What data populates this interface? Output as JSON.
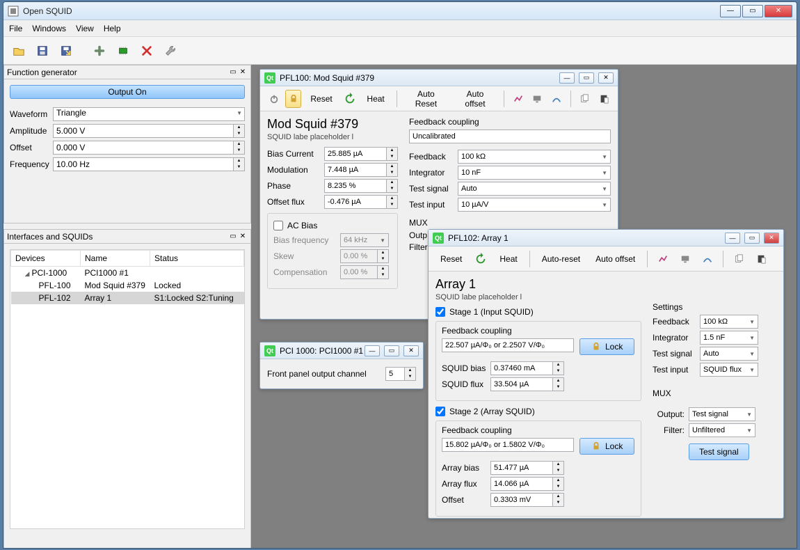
{
  "window": {
    "title": "Open SQUID"
  },
  "menu": {
    "items": [
      "File",
      "Windows",
      "View",
      "Help"
    ]
  },
  "fn_gen": {
    "title": "Function generator",
    "output_btn": "Output On",
    "waveform_label": "Waveform",
    "waveform_value": "Triangle",
    "amplitude_label": "Amplitude",
    "amplitude_value": "5.000 V",
    "offset_label": "Offset",
    "offset_value": "0.000 V",
    "frequency_label": "Frequency",
    "frequency_value": "10.00 Hz"
  },
  "interfaces": {
    "title": "Interfaces and SQUIDs",
    "cols": [
      "Devices",
      "Name",
      "Status"
    ],
    "rows": [
      {
        "indent": 1,
        "expand": true,
        "device": "PCI-1000",
        "name": "PCI1000 #1",
        "status": ""
      },
      {
        "indent": 2,
        "device": "PFL-100",
        "name": "Mod Squid #379",
        "status": "Locked"
      },
      {
        "indent": 2,
        "selected": true,
        "device": "PFL-102",
        "name": "Array 1",
        "status": "S1:Locked  S2:Tuning"
      }
    ]
  },
  "pfl100": {
    "title": "PFL100: Mod Squid #379",
    "toolbar": {
      "reset": "Reset",
      "heat": "Heat",
      "auto_reset": "Auto Reset",
      "auto_offset": "Auto offset"
    },
    "h1": "Mod Squid #379",
    "sub": "SQUID labe placeholder l",
    "left": {
      "bias_current_label": "Bias Current",
      "bias_current": "25.885 µA",
      "modulation_label": "Modulation",
      "modulation": "7.448 µA",
      "phase_label": "Phase",
      "phase": "8.235 %",
      "offset_flux_label": "Offset flux",
      "offset_flux": "-0.476 µA",
      "ac_bias_label": "AC Bias",
      "bias_freq_label": "Bias frequency",
      "bias_freq": "64 kHz",
      "skew_label": "Skew",
      "skew": "0.00 %",
      "comp_label": "Compensation",
      "comp": "0.00 %"
    },
    "right": {
      "fc_label": "Feedback coupling",
      "fc": "Uncalibrated",
      "feedback_label": "Feedback",
      "feedback": "100 kΩ",
      "integrator_label": "Integrator",
      "integrator": "10 nF",
      "test_signal_label": "Test signal",
      "test_signal": "Auto",
      "test_input_label": "Test input",
      "test_input": "10 µA/V",
      "mux_label": "MUX",
      "output_label": "Outp",
      "filter_label": "Filter:"
    }
  },
  "pci1000": {
    "title": "PCI 1000: PCI1000 #1",
    "front_label": "Front panel output channel",
    "front_value": "5"
  },
  "pfl102": {
    "title": "PFL102: Array 1",
    "toolbar": {
      "reset": "Reset",
      "heat": "Heat",
      "auto_reset": "Auto-reset",
      "auto_offset": "Auto offset"
    },
    "h1": "Array 1",
    "sub": "SQUID labe placeholder l",
    "stage1": {
      "label": "Stage 1 (Input SQUID)",
      "fc_label": "Feedback coupling",
      "fc": "22.507 µA/Φ₀ or 2.2507 V/Φ₀",
      "lock": "Lock",
      "squid_bias_label": "SQUID bias",
      "squid_bias": "0.37460 mA",
      "squid_flux_label": "SQUID flux",
      "squid_flux": "33.504 µA"
    },
    "stage2": {
      "label": "Stage 2 (Array SQUID)",
      "fc_label": "Feedback coupling",
      "fc": "15.802 µA/Φ₀ or 1.5802 V/Φ₀",
      "lock": "Lock",
      "array_bias_label": "Array bias",
      "array_bias": "51.477 µA",
      "array_flux_label": "Array flux",
      "array_flux": "14.066 µA",
      "offset_label": "Offset",
      "offset": "0.3303 mV"
    },
    "settings": {
      "label": "Settings",
      "feedback_label": "Feedback",
      "feedback": "100 kΩ",
      "integrator_label": "Integrator",
      "integrator": "1.5 nF",
      "test_signal_label": "Test signal",
      "test_signal": "Auto",
      "test_input_label": "Test input",
      "test_input": "SQUID flux"
    },
    "mux": {
      "label": "MUX",
      "output_label": "Output:",
      "output": "Test signal",
      "filter_label": "Filter:",
      "filter": "Unfiltered",
      "btn": "Test signal"
    }
  }
}
